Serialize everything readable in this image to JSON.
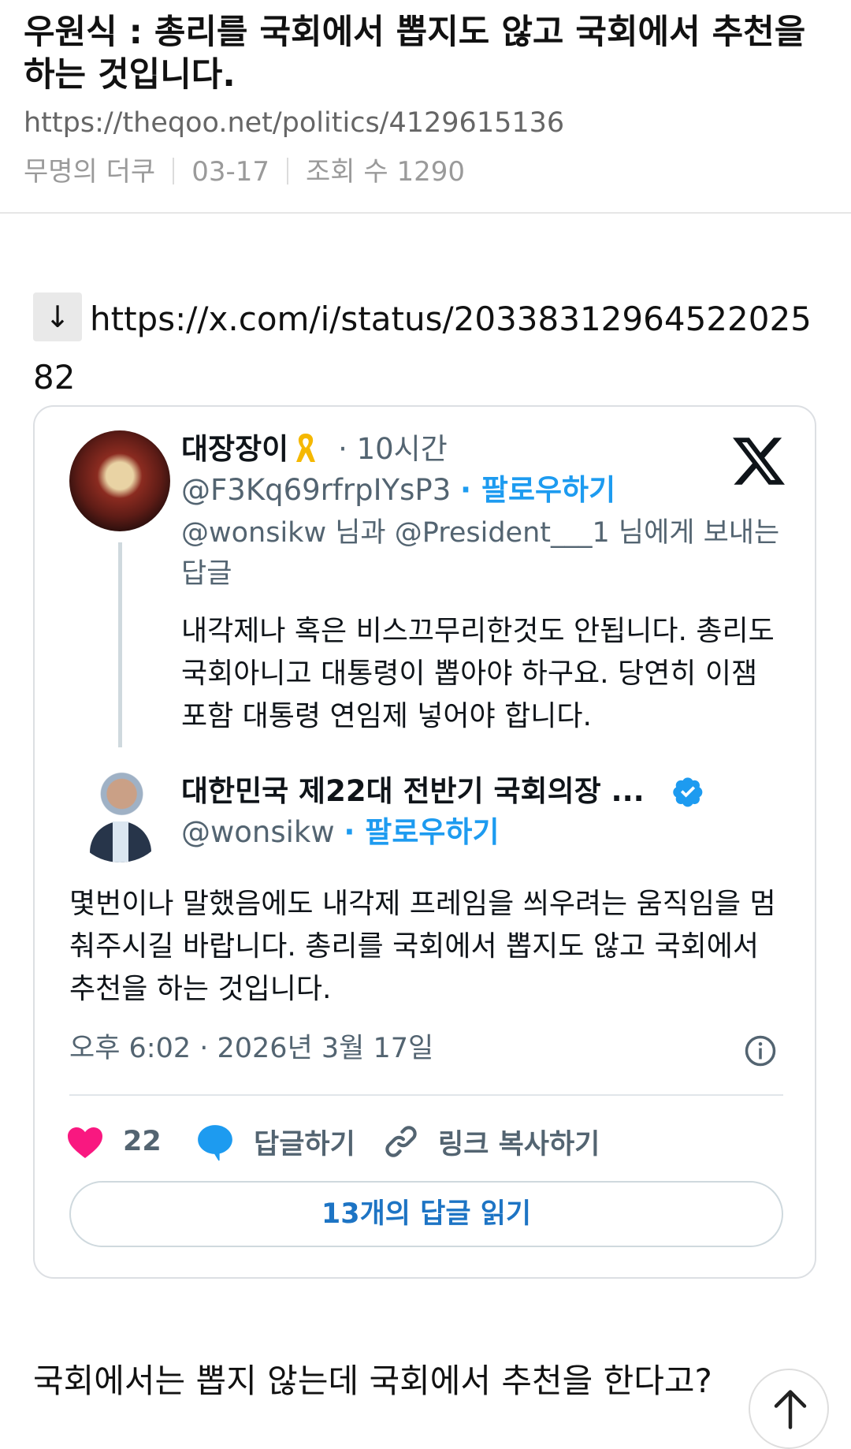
{
  "post": {
    "title": "우원식 : 총리를 국회에서 뽑지도 않고 국회에서 추천을 하는 것입니다.",
    "url": "https://theqoo.net/politics/4129615136",
    "author": "무명의 더쿠",
    "date": "03-17",
    "views": "조회 수 1290"
  },
  "source": {
    "arrow": "↓",
    "link": "https://x.com/i/status/2033831296452202582"
  },
  "tweet": {
    "parent": {
      "display_name": "대장장이",
      "time": "· 10시간",
      "handle": "@F3Kq69rfrpIYsP3",
      "follow_label": "· 팔로우하기",
      "reply_to": "@wonsikw 님과 @President___1 님에게 보내는 답글",
      "text": "내각제나 혹은 비스끄무리한것도 안됩니다. 총리도 국회아니고 대통령이 뽑아야 하구요. 당연히 이잼 포함 대통령 연임제 넣어야 합니다."
    },
    "main": {
      "display_name": "대한민국 제22대 전반기 국회의장 ...",
      "handle": "@wonsikw",
      "follow_label": "· 팔로우하기",
      "text": "몇번이나 말했음에도 내각제 프레임을 씌우려는 움직임을 멈춰주시길 바랍니다. 총리를 국회에서 뽑지도 않고 국회에서 추천을 하는 것입니다.",
      "timestamp": "오후 6:02 · 2026년 3월 17일"
    },
    "actions": {
      "likes": "22",
      "reply_label": "답글하기",
      "copy_link_label": "링크 복사하기"
    },
    "read_replies_label": "13개의 답글 읽기"
  },
  "bottom_comment": "국회에서는 뽑지 않는데 국회에서 추천을 한다고?",
  "colors": {
    "accent": "#1d9bf0",
    "like": "#f91880",
    "muted": "#536471",
    "ribbon": "#f5b800"
  },
  "icons": [
    "x-logo-icon",
    "yellow-ribbon-icon",
    "verified-badge-icon",
    "info-icon",
    "heart-icon",
    "reply-bubble-icon",
    "link-icon",
    "arrow-up-icon"
  ]
}
